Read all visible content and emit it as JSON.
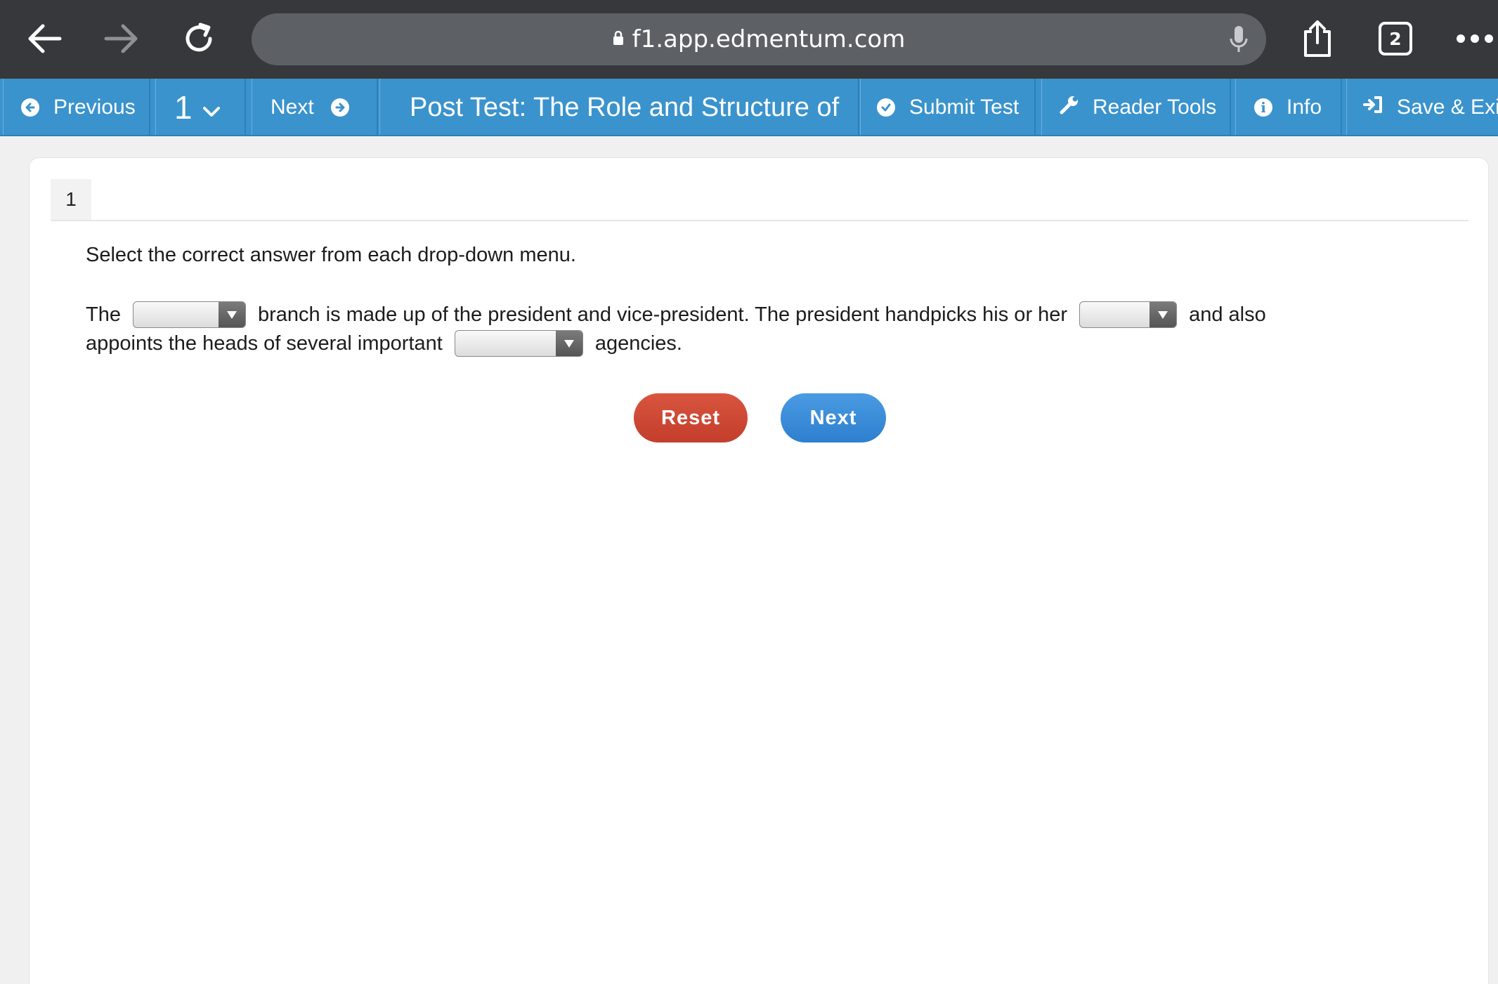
{
  "browser": {
    "url": "f1.app.edmentum.com",
    "tab_count": "2",
    "icons": [
      "back-arrow-icon",
      "forward-arrow-icon",
      "reload-icon",
      "lock-icon",
      "microphone-icon",
      "share-icon",
      "tabs-icon",
      "more-icon"
    ]
  },
  "toolbar": {
    "previous_label": "Previous",
    "question_number": "1",
    "next_label": "Next",
    "title": "Post Test: The Role and Structure of t",
    "submit_label": "Submit Test",
    "reader_tools_label": "Reader Tools",
    "info_label": "Info",
    "save_exit_label": "Save & Exit"
  },
  "question": {
    "number": "1",
    "instruction": "Select the correct answer from each drop-down menu.",
    "line1": {
      "part1": "The",
      "part2": "branch is made up of the president and vice-president. The president handpicks his or her",
      "part3": "and also"
    },
    "line2": {
      "part1": "appoints the heads of several important",
      "part2": "agencies."
    },
    "dropdowns": [
      {
        "selected": ""
      },
      {
        "selected": ""
      },
      {
        "selected": ""
      }
    ]
  },
  "buttons": {
    "reset_label": "Reset",
    "next_label": "Next"
  },
  "colors": {
    "browser_bar": "#36383b",
    "toolbar": "#3a93cd",
    "reset": "#c9452f",
    "next": "#3a8bd8"
  }
}
